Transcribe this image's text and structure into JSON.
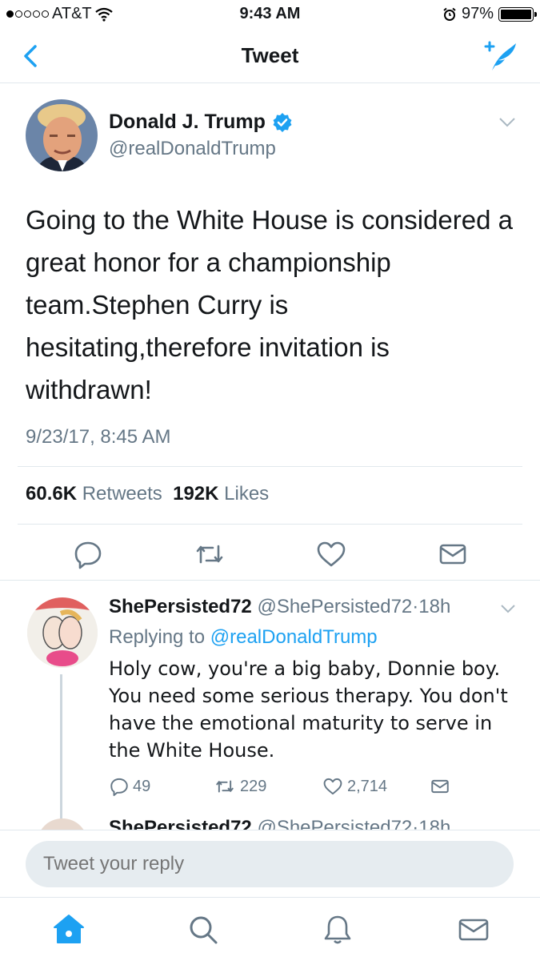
{
  "status_bar": {
    "carrier": "AT&T",
    "time": "9:43 AM",
    "battery": "97%"
  },
  "nav": {
    "title": "Tweet"
  },
  "tweet": {
    "author_name": "Donald J. Trump",
    "author_handle": "@realDonaldTrump",
    "text": "Going to the White House is considered a great honor for a championship team.Stephen Curry is hesitating,therefore invitation is withdrawn!",
    "timestamp": "9/23/17, 8:45 AM",
    "retweet_count": "60.6K",
    "retweet_label": "Retweets",
    "like_count": "192K",
    "like_label": "Likes"
  },
  "reply": {
    "name": "ShePersisted72",
    "handle": "@ShePersisted72",
    "time": "18h",
    "replying_prefix": "Replying to",
    "replying_to": "@realDonaldTrump",
    "text": "Holy cow, you're a big baby, Donnie boy. You need some serious therapy. You don't have the emotional maturity to serve in the White House.",
    "reply_count": "49",
    "retweet_count": "229",
    "like_count": "2,714"
  },
  "next_reply": {
    "name": "ShePersisted72",
    "handle": "@ShePersisted72",
    "time": "18h"
  },
  "reply_box": {
    "placeholder": "Tweet your reply"
  },
  "colors": {
    "accent": "#1da1f2",
    "secondary_text": "#657786",
    "primary_text": "#14171a",
    "divider": "#e1e8ed"
  },
  "icons": [
    "back-chevron-icon",
    "compose-icon",
    "verified-icon",
    "reply-icon",
    "retweet-icon",
    "like-icon",
    "message-icon",
    "home-icon",
    "search-icon",
    "notifications-icon",
    "messages-icon"
  ]
}
